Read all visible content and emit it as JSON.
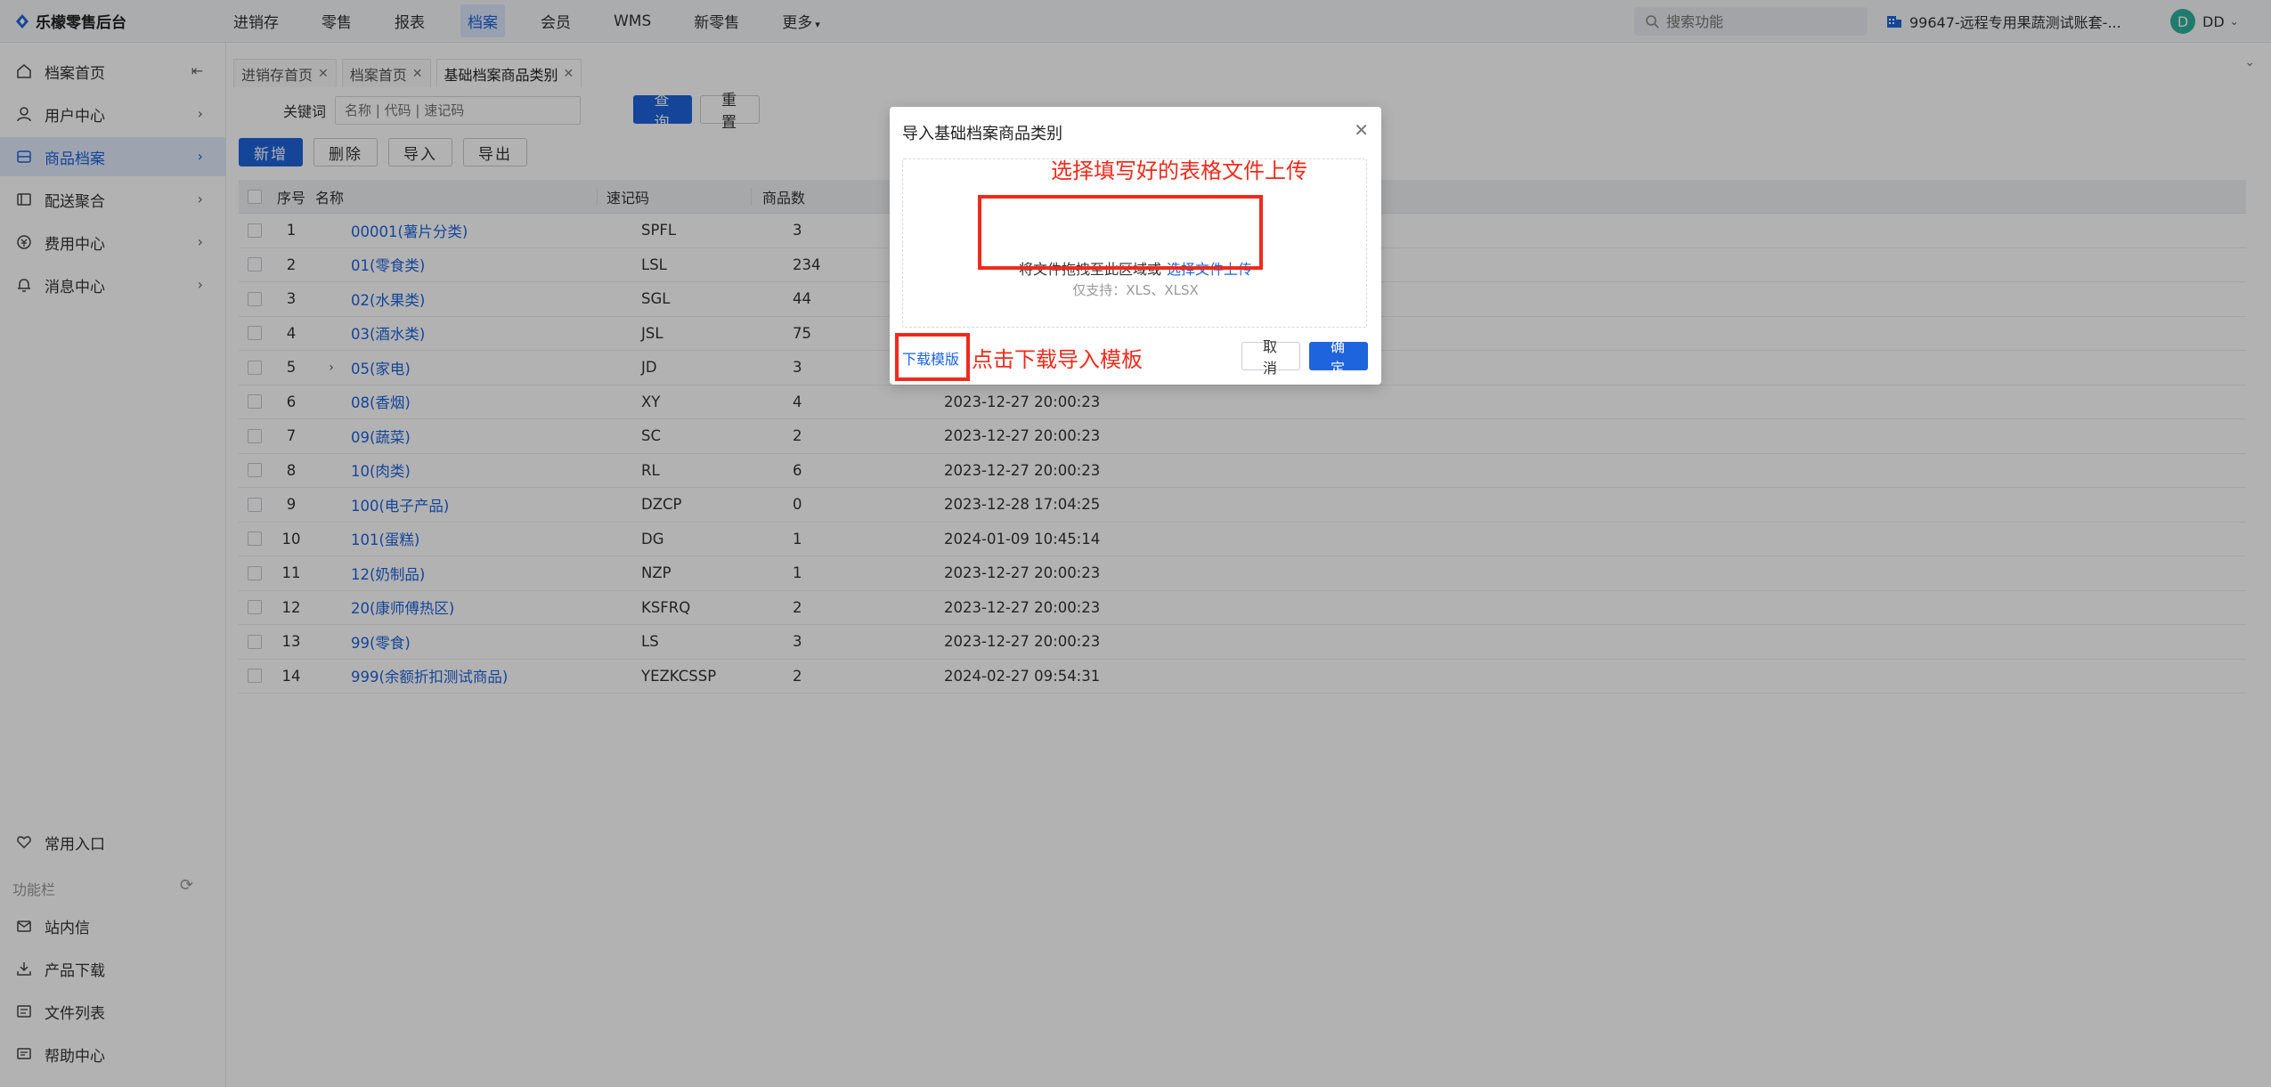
{
  "app": {
    "brand": "乐檬零售后台"
  },
  "topnav": [
    {
      "label": "进销存",
      "active": false
    },
    {
      "label": "零售",
      "active": false
    },
    {
      "label": "报表",
      "active": false
    },
    {
      "label": "档案",
      "active": true
    },
    {
      "label": "会员",
      "active": false
    },
    {
      "label": "WMS",
      "active": false
    },
    {
      "label": "新零售",
      "active": false
    },
    {
      "label": "更多",
      "active": false
    }
  ],
  "search": {
    "placeholder": "搜索功能"
  },
  "account": {
    "name": "99647-远程专用果蔬测试账套-..."
  },
  "user": {
    "initial": "D",
    "name": "DD"
  },
  "sidebar": {
    "items": [
      {
        "label": "档案首页",
        "icon": "home-icon"
      },
      {
        "label": "用户中心",
        "icon": "user-icon"
      },
      {
        "label": "商品档案",
        "icon": "goods-icon",
        "active": true
      },
      {
        "label": "配送聚合",
        "icon": "delivery-icon"
      },
      {
        "label": "费用中心",
        "icon": "cost-icon"
      },
      {
        "label": "消息中心",
        "icon": "bell-icon"
      }
    ],
    "favorites": "常用入口",
    "section_label": "功能栏",
    "bottom_items": [
      {
        "label": "站内信",
        "icon": "mail-icon"
      },
      {
        "label": "产品下载",
        "icon": "download-icon"
      },
      {
        "label": "文件列表",
        "icon": "file-list-icon"
      },
      {
        "label": "帮助中心",
        "icon": "help-icon"
      }
    ]
  },
  "tabs": [
    {
      "label": "进销存首页",
      "active": false
    },
    {
      "label": "档案首页",
      "active": false
    },
    {
      "label": "基础档案商品类别",
      "active": true
    }
  ],
  "filter": {
    "label": "关键词",
    "placeholder": "名称 | 代码 | 速记码",
    "query": "查询",
    "reset": "重置"
  },
  "toolbar": {
    "add": "新增",
    "delete": "删除",
    "import": "导入",
    "export": "导出"
  },
  "table": {
    "headers": {
      "no": "序号",
      "name": "名称",
      "code": "速记码",
      "count": "商品数"
    },
    "rows": [
      {
        "no": "1",
        "name": "00001(薯片分类)",
        "code": "SPFL",
        "count": "3",
        "time": ""
      },
      {
        "no": "2",
        "name": "01(零食类)",
        "code": "LSL",
        "count": "234",
        "time": ""
      },
      {
        "no": "3",
        "name": "02(水果类)",
        "code": "SGL",
        "count": "44",
        "time": ""
      },
      {
        "no": "4",
        "name": "03(酒水类)",
        "code": "JSL",
        "count": "75",
        "time": ""
      },
      {
        "no": "5",
        "name": "05(家电)",
        "code": "JD",
        "count": "3",
        "time": "",
        "expand": "›"
      },
      {
        "no": "6",
        "name": "08(香烟)",
        "code": "XY",
        "count": "4",
        "time": "2023-12-27 20:00:23"
      },
      {
        "no": "7",
        "name": "09(蔬菜)",
        "code": "SC",
        "count": "2",
        "time": "2023-12-27 20:00:23"
      },
      {
        "no": "8",
        "name": "10(肉类)",
        "code": "RL",
        "count": "6",
        "time": "2023-12-27 20:00:23"
      },
      {
        "no": "9",
        "name": "100(电子产品)",
        "code": "DZCP",
        "count": "0",
        "time": "2023-12-28 17:04:25"
      },
      {
        "no": "10",
        "name": "101(蛋糕)",
        "code": "DG",
        "count": "1",
        "time": "2024-01-09 10:45:14"
      },
      {
        "no": "11",
        "name": "12(奶制品)",
        "code": "NZP",
        "count": "1",
        "time": "2023-12-27 20:00:23"
      },
      {
        "no": "12",
        "name": "20(康师傅热区)",
        "code": "KSFRQ",
        "count": "2",
        "time": "2023-12-27 20:00:23"
      },
      {
        "no": "13",
        "name": "99(零食)",
        "code": "LS",
        "count": "3",
        "time": "2023-12-27 20:00:23"
      },
      {
        "no": "14",
        "name": "999(余额折扣测试商品)",
        "code": "YEZKCSSP",
        "count": "2",
        "time": "2024-02-27 09:54:31"
      }
    ]
  },
  "modal": {
    "title": "导入基础档案商品类别",
    "annotation_upload": "选择填写好的表格文件上传",
    "drop_text": "将文件拖拽至此区域或",
    "drop_link": "选择文件上传",
    "drop_hint": "仅支持：XLS、XLSX",
    "download_link": "下载模版",
    "annotation_download": "点击下载导入模板",
    "cancel": "取 消",
    "ok": "确 定"
  },
  "colors": {
    "accent": "#1e64dc",
    "annotation": "#f02a1c",
    "overlay": "rgba(0,0,0,0.30)"
  }
}
